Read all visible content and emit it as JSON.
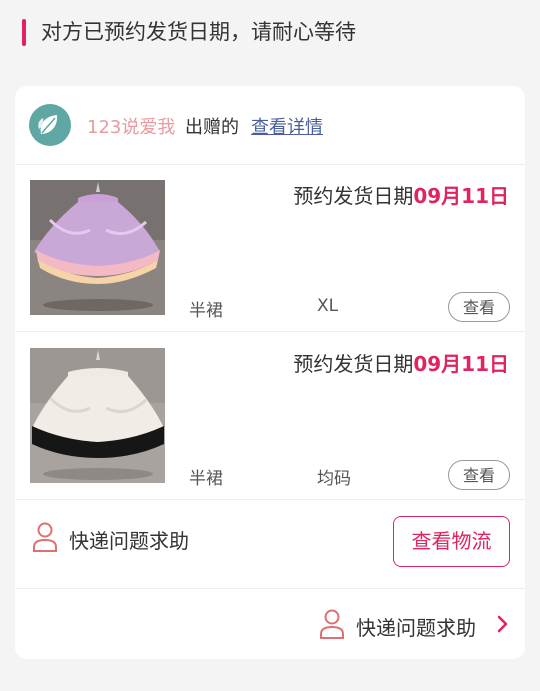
{
  "banner": {
    "title": "对方已预约发货日期，请耐心等待"
  },
  "donor": {
    "username": "123说爱我",
    "gives_text": "出赠的",
    "detail_link": "查看详情"
  },
  "items": [
    {
      "ship_label": "预约发货日期",
      "ship_date": "09月11日",
      "category": "半裙",
      "size": "XL",
      "view_label": "查看",
      "image": "purple-pink tutu skirt"
    },
    {
      "ship_label": "预约发货日期",
      "ship_date": "09月11日",
      "category": "半裙",
      "size": "均码",
      "view_label": "查看",
      "image": "white tutu skirt with black trim"
    }
  ],
  "help_row": {
    "text": "快递问题求助",
    "button": "查看物流",
    "icon": "person-icon"
  },
  "footer": {
    "text": "快递问题求助",
    "icon": "person-icon",
    "chevron": "chevron-right-icon"
  },
  "colors": {
    "accent": "#e0245e",
    "link": "#4a5fa0",
    "username": "#e89aa0",
    "logo": "#5fa7a3"
  }
}
